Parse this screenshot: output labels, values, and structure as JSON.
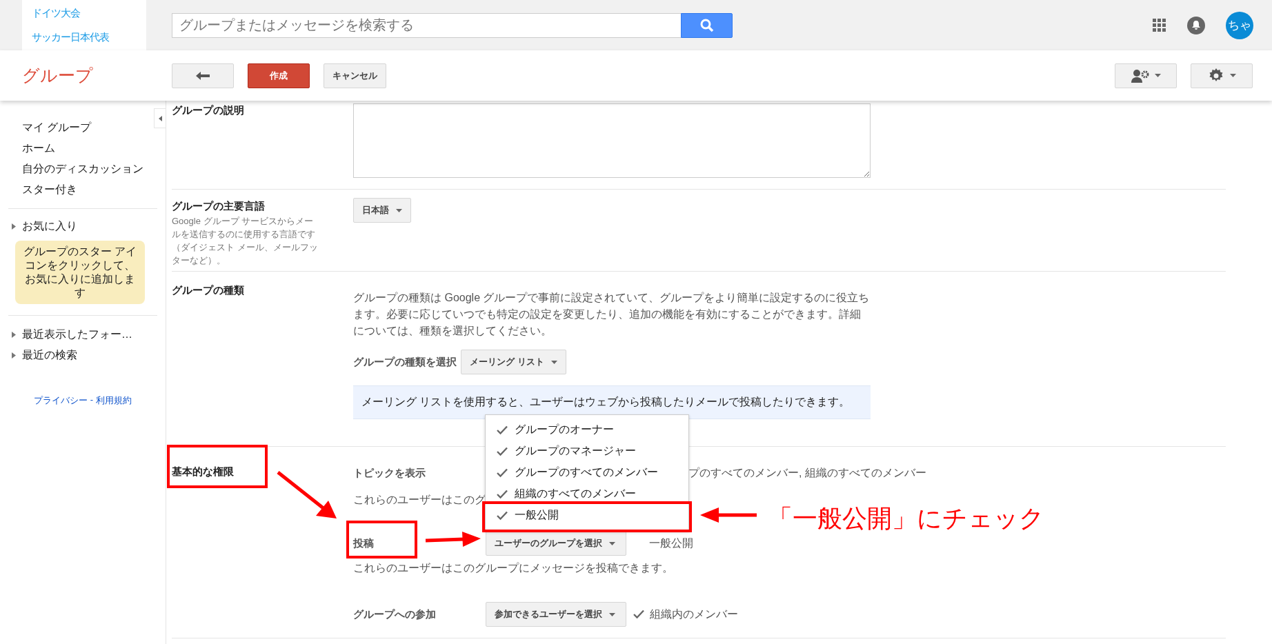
{
  "top_bar": {
    "recent_groups": [
      "ドイツ大会",
      "サッカー日本代表"
    ],
    "search": {
      "placeholder": "グループまたはメッセージを検索する"
    },
    "avatar": "ちゃ"
  },
  "toolbar": {
    "title": "グループ",
    "buttons": [
      {
        "kind": "back"
      },
      {
        "kind": "primary",
        "label": "作成"
      },
      {
        "kind": "plain",
        "label": "キャンセル"
      }
    ],
    "right_buttons": [
      {
        "kind": "members"
      },
      {
        "kind": "settings"
      }
    ]
  },
  "sidebar": {
    "nav": [
      "マイ グループ",
      "ホーム",
      "自分のディスカッション",
      "スター付き"
    ],
    "favorites": {
      "label": "お気に入り",
      "expanded": false,
      "note": "グループのスター アイコンをクリックして、お気に入りに追加します"
    },
    "sections": [
      {
        "label": "最近表示したフォー…",
        "expanded": false
      },
      {
        "label": "最近の検索",
        "expanded": false
      }
    ],
    "footer": {
      "links": [
        "プライバシー",
        "利用規約"
      ],
      "separator": "-"
    }
  },
  "form": {
    "description": {
      "label": "グループの説明"
    },
    "language": {
      "label": "グループの主要言語",
      "help": "Google グループ サービスからメールを送信するのに使用する言語です（ダイジェスト メール、メールフッターなど）。",
      "value": "日本語"
    },
    "type": {
      "label": "グループの種類",
      "text": "グループの種類は Google グループで事前に設定されていて、グループをより簡単に設定するのに役立ちます。必要に応じていつでも特定の設定を変更したり、追加の機能を有効にすることができます。詳細については、種類を選択してください。",
      "select_label": "グループの種類を選択",
      "value": "メーリング リスト",
      "info": "メーリング リストを使用すると、ユーザーはウェブから投稿したりメールで投稿したりできます。"
    },
    "permissions": {
      "label": "基本的な権限",
      "rows": [
        {
          "label": "トピックを表示",
          "value": "プのすべてのメンバー, 組織のすべてのメンバー",
          "help": "これらのユーザーはこのグ"
        },
        {
          "label": "投稿",
          "button": "ユーザーのグループを選択",
          "value": "一般公開",
          "help": "これらのユーザーはこのグループにメッセージを投稿できます。"
        },
        {
          "label": "グループへの参加",
          "button": "参加できるユーザーを選択",
          "value": "組織内のメンバー",
          "checked": true
        }
      ]
    },
    "menu": [
      {
        "label": "グループのオーナー",
        "checked": true
      },
      {
        "label": "グループのマネージャー",
        "checked": true
      },
      {
        "label": "グループのすべてのメンバー",
        "checked": true
      },
      {
        "label": "組織のすべてのメンバー",
        "checked": true
      },
      {
        "label": "一般公開",
        "checked": true
      }
    ]
  },
  "annotation": {
    "callout": "「一般公開」にチェック"
  }
}
